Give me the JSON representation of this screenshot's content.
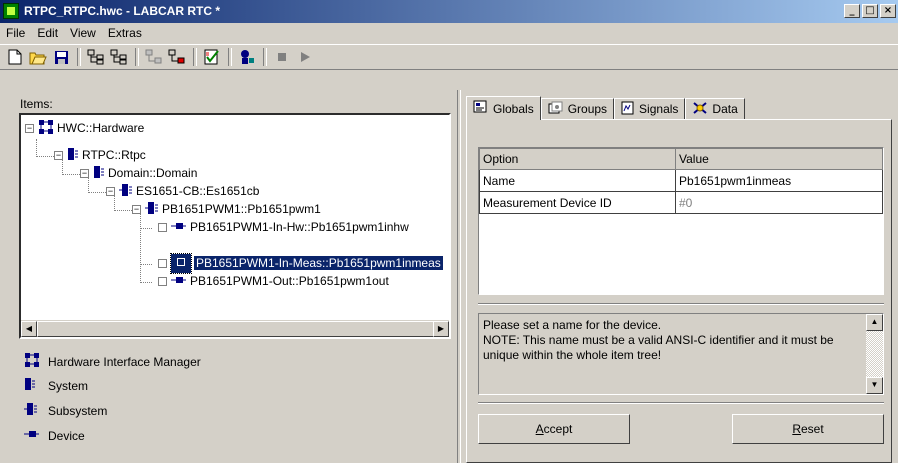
{
  "window": {
    "title": "RTPC_RTPC.hwc - LABCAR RTC  *",
    "minimize": "_",
    "maximize": "□",
    "close": "×"
  },
  "menu": [
    "File",
    "Edit",
    "View",
    "Extras"
  ],
  "toolbar": {
    "icons": [
      "new-icon",
      "open-icon",
      "save-icon",
      "tree-expand-icon",
      "tree-collapse-icon",
      "move-icon",
      "sort-icon",
      "check-icon",
      "connect-icon",
      "stop-icon",
      "play-icon"
    ]
  },
  "items_panel": {
    "label": "Items:",
    "tree": [
      {
        "label": "HWC::Hardware",
        "level": 0,
        "expander": "−"
      },
      {
        "label": "RTPC::Rtpc",
        "level": 1,
        "expander": "−"
      },
      {
        "label": "Domain::Domain",
        "level": 2,
        "expander": "−"
      },
      {
        "label": "ES1651-CB::Es1651cb",
        "level": 3,
        "expander": "−"
      },
      {
        "label": "PB1651PWM1::Pb1651pwm1",
        "level": 4,
        "expander": "−"
      },
      {
        "label": "PB1651PWM1-In-Hw::Pb1651pwm1inhw",
        "level": 5,
        "expander": ""
      },
      {
        "label": "PB1651PWM1-In-Meas::Pb1651pwm1inmeas",
        "level": 5,
        "expander": "",
        "selected": true
      },
      {
        "label": "PB1651PWM1-Out::Pb1651pwm1out",
        "level": 5,
        "expander": ""
      }
    ],
    "legend": [
      {
        "label": "Hardware Interface Manager",
        "icon": "hwm-icon"
      },
      {
        "label": "System",
        "icon": "system-icon"
      },
      {
        "label": "Subsystem",
        "icon": "subsystem-icon"
      },
      {
        "label": "Device",
        "icon": "device-icon"
      }
    ]
  },
  "tabs": [
    {
      "label": "Globals",
      "icon": "globals-icon",
      "active": true
    },
    {
      "label": "Groups",
      "icon": "groups-icon"
    },
    {
      "label": "Signals",
      "icon": "signals-icon"
    },
    {
      "label": "Data",
      "icon": "data-icon"
    }
  ],
  "properties": {
    "columns": [
      "Option",
      "Value"
    ],
    "rows": [
      {
        "option": "Name",
        "value": "Pb1651pwm1inmeas"
      },
      {
        "option": "Measurement Device ID",
        "value": "#0"
      }
    ]
  },
  "description": "Please set a name for the device.\nNOTE: This name must be a valid ANSI-C identifier and it must be unique within the whole item tree!",
  "buttons": {
    "accept": "Accept",
    "reset": "Reset"
  }
}
